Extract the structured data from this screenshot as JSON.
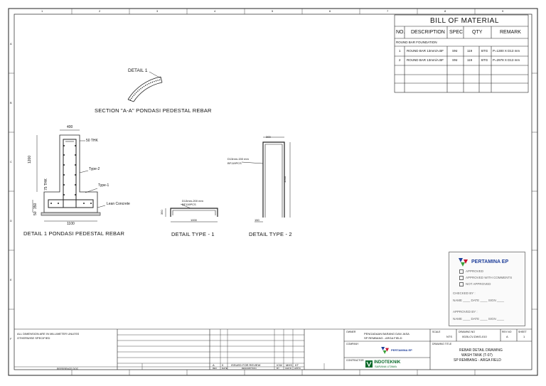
{
  "bom": {
    "title": "BILL OF MATERIAL",
    "headers": [
      "NO.",
      "DESCRIPTION",
      "SPEC",
      "QTY",
      "REMARK"
    ],
    "group": "ROUND BAR FOUNDATION",
    "rows": [
      {
        "no": "1",
        "desc": "ROUND BAR 13mm/A.BF",
        "spec": "SNI",
        "qty": "119",
        "unit": "BTG",
        "remark": "P=1300 X D13 mm"
      },
      {
        "no": "2",
        "desc": "ROUND BAR 13mm/A.BF",
        "spec": "SNI",
        "qty": "119",
        "unit": "BTG",
        "remark": "P=2978 X D13 mm"
      }
    ]
  },
  "section": {
    "title": "SECTION \"A-A\" PONDASI PEDESTAL REBAR",
    "tag": "DETAIL 1"
  },
  "detail1": {
    "title": "DETAIL 1 PONDASI PEDESTAL REBAR",
    "dim_top": "400",
    "dim_thk": "50 THK",
    "dim_height": "1200",
    "dim_thk75": "75 THK",
    "dim_350": "350",
    "dim_50": "50",
    "dim_bottom": "1100",
    "type2": "Type-2",
    "type1": "Type-1",
    "lean": "Lean Concrete"
  },
  "type1": {
    "title": "DETAIL TYPE - 1",
    "note1": "D13mm-200 mm",
    "note2": "BF119PCS",
    "dim_len": "1000",
    "dim_h": "350"
  },
  "type2": {
    "title": "DETAIL TYPE - 2",
    "note1": "D13mm-150 mm",
    "note2": "BF119PCS",
    "dim_top": "300",
    "dim_side": "1500",
    "dim_bottom": "150"
  },
  "stamp": {
    "brand": "PERTAMINA EP",
    "options": [
      "APPROVED",
      "APPROVED WITH COMMENTS",
      "NOT APPROVED"
    ],
    "checked_by": "CHECKED BY :",
    "approved_by": "APPROVED BY :",
    "fields": "NAME ____ DATE ____ SIGN ____"
  },
  "title_block": {
    "notes_line1": "ALL DIMENSION ARE IN MILLIMETER UNLESS",
    "notes_line2": "OTHERWISE SPECIFIED",
    "reference": "REFERENCE DOC",
    "rev_headers": [
      "A",
      "0",
      "ISSUED FOR REVIEW",
      "ICW",
      "MHS",
      "KT"
    ],
    "rev_labels": [
      "REV",
      "DATE",
      "DESCRIPTION",
      "BY",
      "CHK'D",
      "APP'D"
    ],
    "owner_label": "OWNER",
    "project": "PENGADAAN BARANG DAN JASA",
    "project2": "SP REMBANG - ARGA FIELD",
    "company_label": "COMPANY",
    "contractor_label": "CONTRACTOR",
    "contractor": "INDOTEKNIK",
    "contractor_sub": "SARANA UTAMA",
    "drawing_title_label": "DRAWING TITLE",
    "drawing_title1": "REBAR DETAIL DRAWING",
    "drawing_title2": "WASH TANK (T-07)",
    "drawing_title3": "SP REMBANG - ARGA FIELD",
    "scale_label": "SCALE",
    "scale": "NTS",
    "dwg_no_label": "DRAWING NO",
    "dwg_no": "0026-CV-DWG-010",
    "rev_label": "REV NO",
    "rev": "A",
    "sheet_label": "SHEET",
    "sheet": "1"
  },
  "grid": {
    "cols": [
      "1",
      "2",
      "3",
      "4",
      "5",
      "6",
      "7",
      "8",
      "9"
    ],
    "rows": [
      "A",
      "B",
      "C",
      "D",
      "E",
      "F"
    ]
  }
}
